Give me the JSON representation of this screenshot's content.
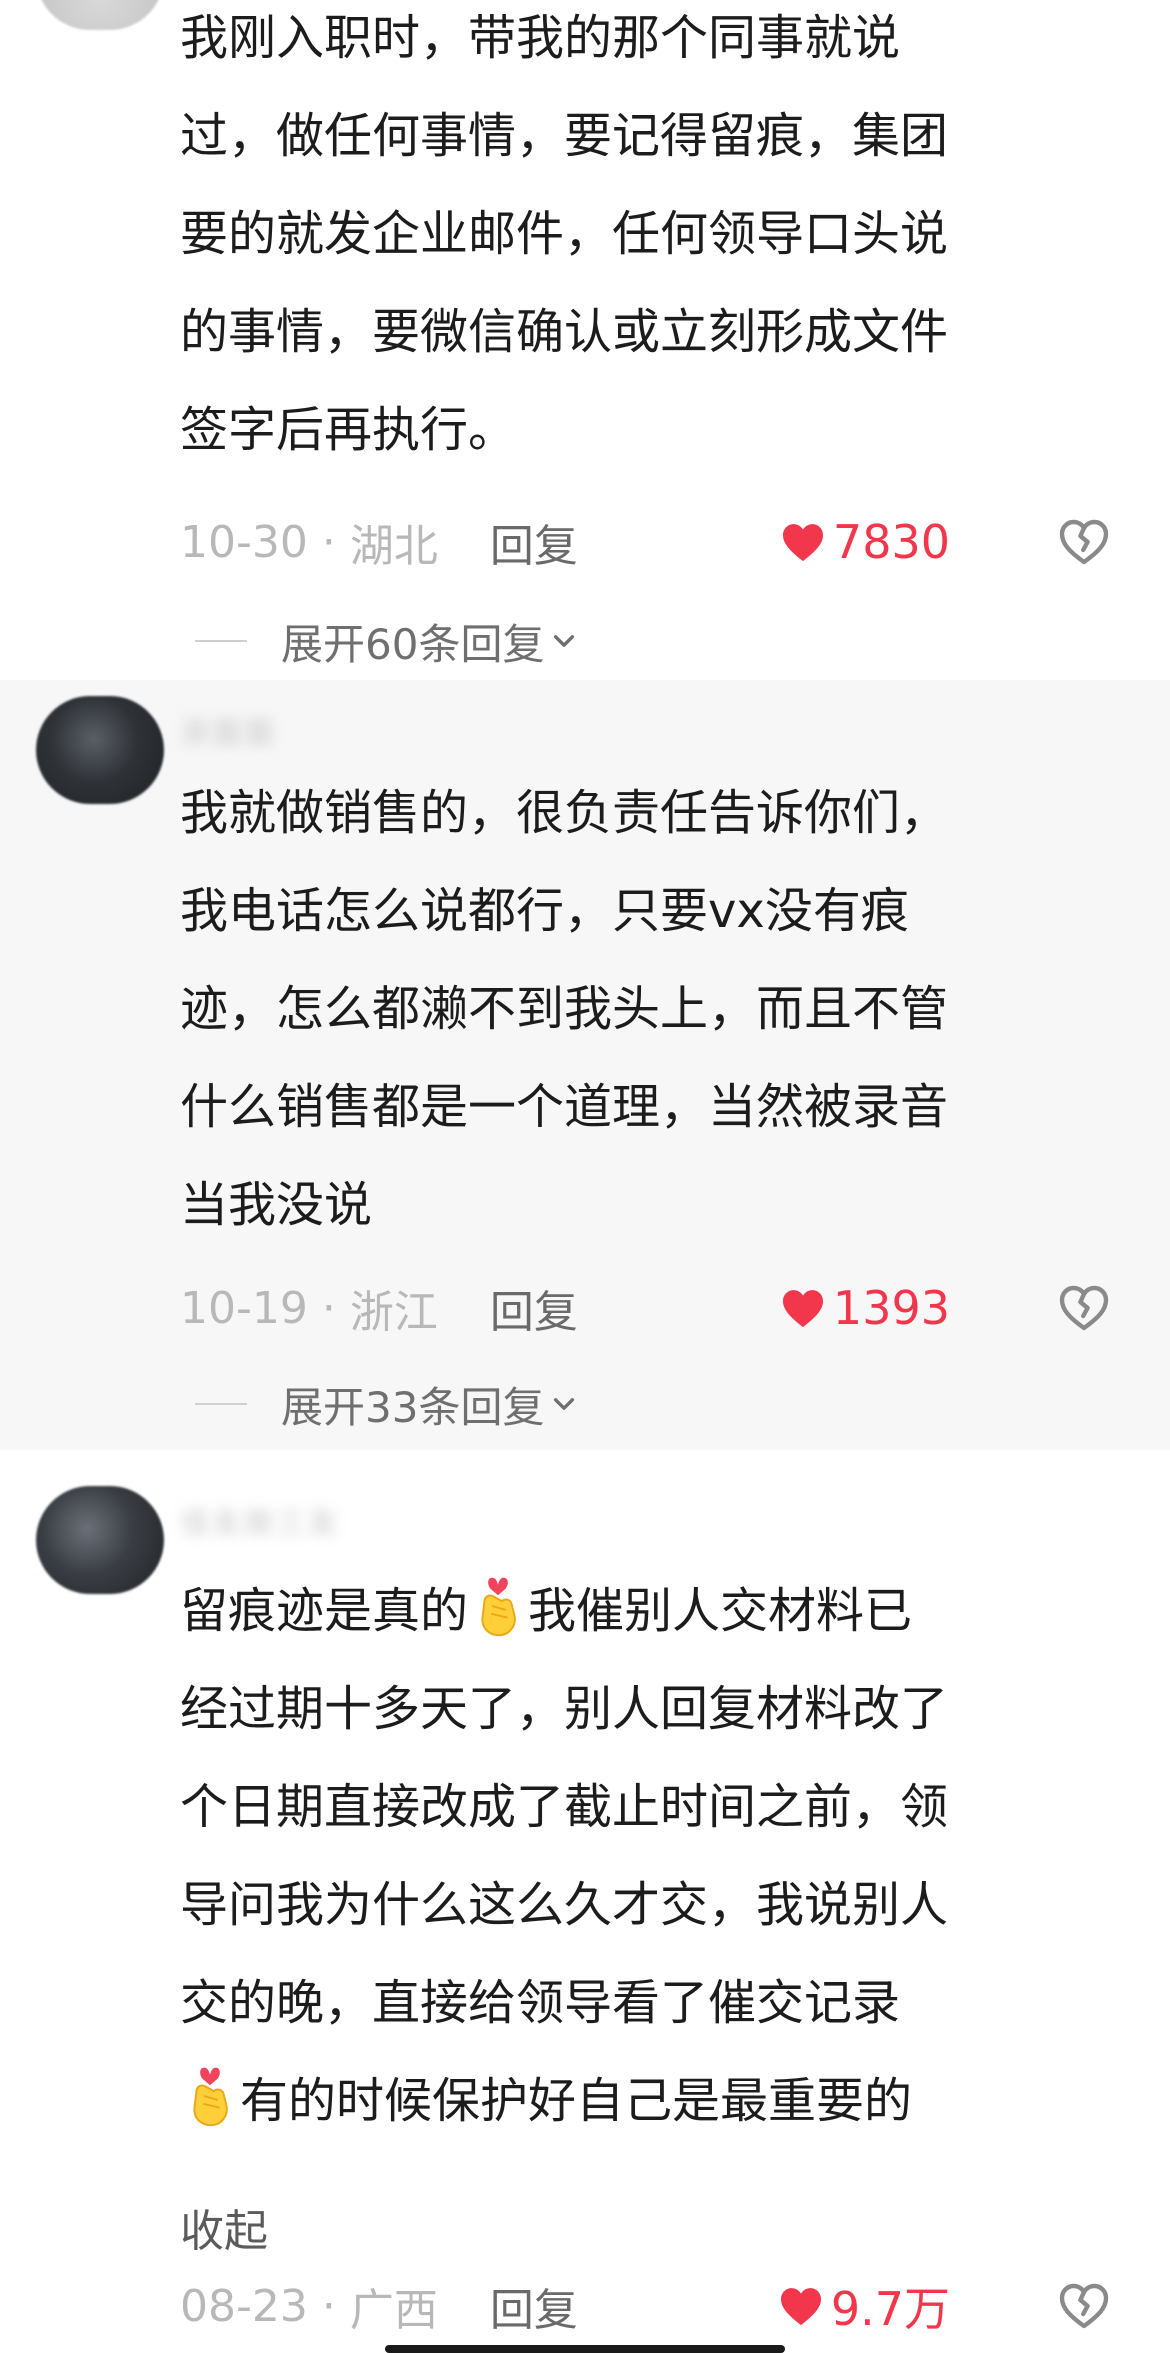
{
  "comments": [
    {
      "username": "",
      "content_lines": [
        "我刚入职时，带我的那个同事就说",
        "过，做任何事情，要记得留痕，集团",
        "要的就发企业邮件，任何领导口头说",
        "的事情，要微信确认或立刻形成文件",
        "签字后再执行。"
      ],
      "date": "10-30",
      "separator": "·",
      "region": "湖北",
      "reply_label": "回复",
      "likes": "7830",
      "expand_label": "展开60条回复"
    },
    {
      "username": "浙面面",
      "content_lines": [
        "我就做销售的，很负责任告诉你们，",
        "我电话怎么说都行，只要vx没有痕",
        "迹，怎么都濑不到我头上，而且不管",
        "什么销售都是一个道理，当然被录音",
        "当我没说"
      ],
      "date": "10-19",
      "separator": "·",
      "region": "浙江",
      "reply_label": "回复",
      "likes": "1393",
      "expand_label": "展开33条回复"
    },
    {
      "username": "佳友故三友",
      "content_lines": [
        "留痕迹是真的",
        "我催别人交材料已",
        "经过期十多天了，别人回复材料改了",
        "个日期直接改成了截止时间之前，领",
        "导问我为什么这么久才交，我说别人",
        "交的晚，直接给领导看了催交记录",
        "有的时候保护好自己是最重要的"
      ],
      "collapse_label": "收起",
      "date": "08-23",
      "separator": "·",
      "region": "广西",
      "reply_label": "回复",
      "likes": "9.7万"
    }
  ],
  "icons": {
    "like": "heart-filled-icon",
    "dislike": "broken-heart-outline-icon",
    "expand": "chevron-down-icon",
    "emoji": "finger-heart-emoji"
  },
  "colors": {
    "like": "#f2364c",
    "meta": "#b8b8b8",
    "alt_background": "#f7f7f7"
  }
}
